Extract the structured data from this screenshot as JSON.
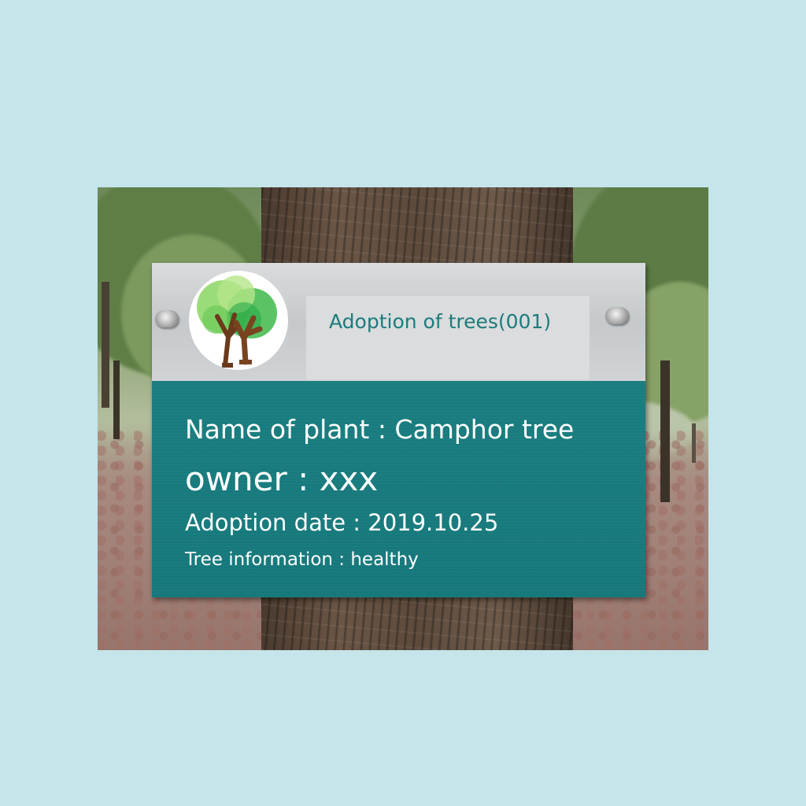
{
  "sign": {
    "title": "Adoption of trees(001)",
    "plant_name": "Name of plant : Camphor tree",
    "owner": "owner : xxx",
    "adoption_date": "Adoption date : 2019.10.25",
    "tree_information": "Tree information : healthy"
  },
  "colors": {
    "page_background": "#c5e5eb",
    "sign_teal": "#1a7d80",
    "sign_silver": "#d0d3d5",
    "title_text": "#1d7b7d",
    "body_text": "#ffffff"
  },
  "icons": {
    "logo": "tree-logo-icon",
    "bolts": "bolt-icon"
  }
}
